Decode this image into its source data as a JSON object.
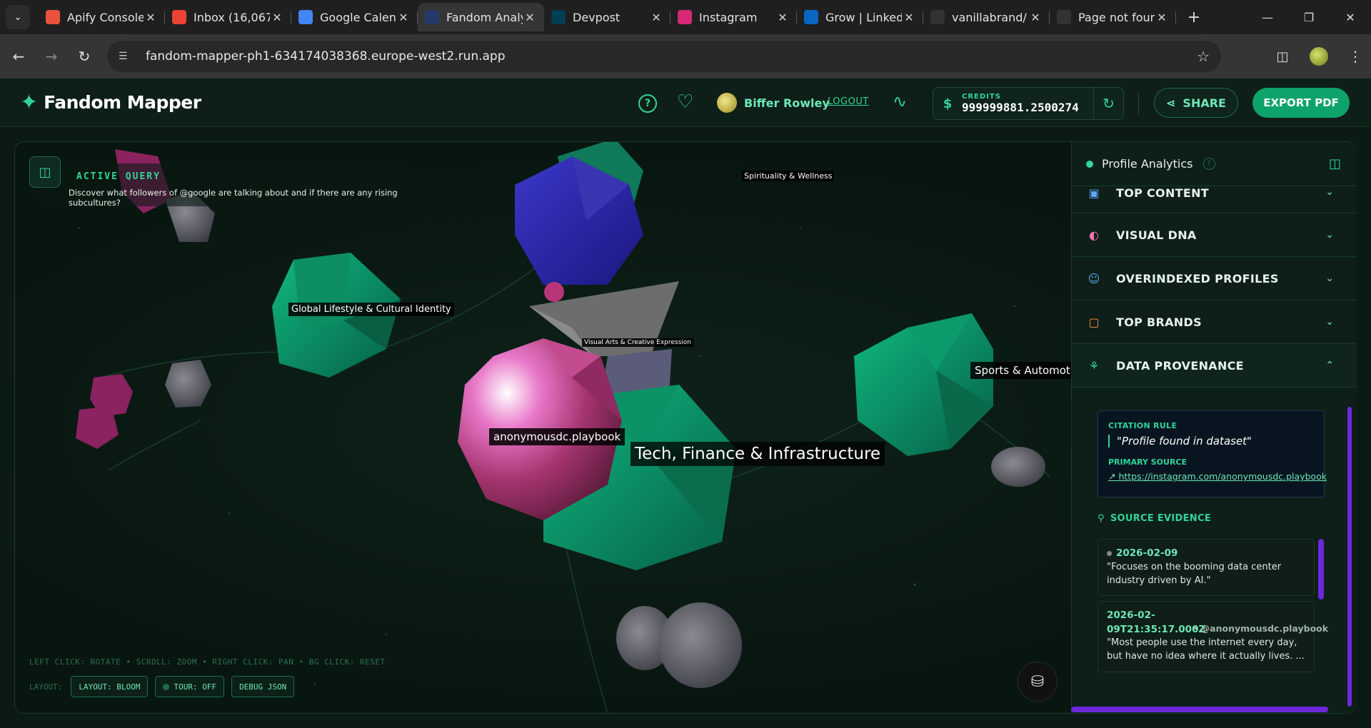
{
  "browser": {
    "tabs": [
      {
        "label": "Apify Console",
        "favicon": "apify-icon",
        "color": "#e9523d"
      },
      {
        "label": "Inbox (16,067)",
        "favicon": "gmail-icon",
        "color": "#ea4335"
      },
      {
        "label": "Google Calendar",
        "favicon": "calendar-icon",
        "color": "#4285f4"
      },
      {
        "label": "Fandom Analytics",
        "favicon": "fandom-icon",
        "color": "#233a6b"
      },
      {
        "label": "Devpost",
        "favicon": "devpost-icon",
        "color": "#003e54"
      },
      {
        "label": "Instagram",
        "favicon": "instagram-icon",
        "color": "#d62976"
      },
      {
        "label": "Grow | LinkedIn",
        "favicon": "linkedin-icon",
        "color": "#0a66c2"
      },
      {
        "label": "vanillabrand/",
        "favicon": "github-icon",
        "color": "#333333"
      },
      {
        "label": "Page not found",
        "favicon": "github-icon",
        "color": "#333333"
      }
    ],
    "url": "fandom-mapper-ph1-634174038368.europe-west2.run.app"
  },
  "header": {
    "brand": "Fandom Mapper",
    "user_name": "Biffer Rowley",
    "logout": "LOGOUT",
    "credits_label": "CREDITS",
    "credits_value": "999999881.2500274",
    "share": "SHARE",
    "export": "EXPORT PDF",
    "accent": "#34d399"
  },
  "canvas": {
    "query_label": "ACTIVE QUERY",
    "query_text": "Discover what followers of @google are talking about and if there are any rising subcultures?",
    "nodes": {
      "spirituality": "Spirituality & Wellness",
      "global": "Global Lifestyle & Cultural Identity",
      "visual_arts": "Visual Arts & Creative Expression",
      "sports": "Sports & Automotive",
      "profile": "anonymousdc.playbook",
      "tech": "Tech, Finance & Infrastructure"
    },
    "hint": "LEFT CLICK: ROTATE • SCROLL: ZOOM • RIGHT CLICK: PAN • BG CLICK: RESET",
    "layout_label": "LAYOUT:",
    "layout_chip": "LAYOUT: BLOOM",
    "tour_chip": "TOUR: OFF",
    "debug_chip": "DEBUG JSON"
  },
  "panel": {
    "title": "Profile Analytics",
    "sections": [
      {
        "label": "TOP CONTENT",
        "icon": "image-icon",
        "color": "#60a5fa"
      },
      {
        "label": "VISUAL DNA",
        "icon": "palette-icon",
        "color": "#f472b6"
      },
      {
        "label": "OVERINDEXED PROFILES",
        "icon": "users-icon",
        "color": "#60a5fa"
      },
      {
        "label": "TOP BRANDS",
        "icon": "bag-icon",
        "color": "#fb923c"
      },
      {
        "label": "DATA PROVENANCE",
        "icon": "provenance-icon",
        "color": "#34d399"
      }
    ],
    "citation_label": "CITATION RULE",
    "citation_quote": "\"Profile found in dataset\"",
    "primary_label": "PRIMARY SOURCE",
    "primary_link": "https://instagram.com/anonymousdc.playbook",
    "evidence_label": "SOURCE EVIDENCE",
    "evidence": [
      {
        "date": "2026-02-09",
        "handle": "",
        "text": "\"Focuses on the booming data center industry driven by AI.\""
      },
      {
        "date": "2026-02-09T21:35:17.000Z",
        "handle": "@anonymousdc.playbook",
        "text": "\"Most people use the internet every day, but have no idea where it actually lives. ..."
      }
    ]
  }
}
